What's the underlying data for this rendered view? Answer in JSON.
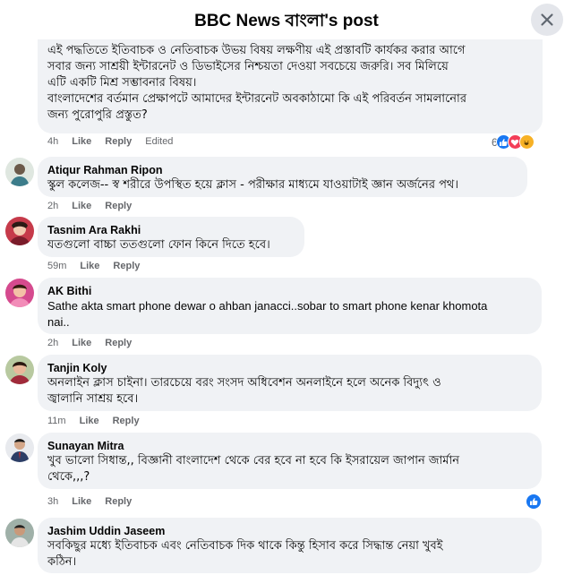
{
  "header": {
    "title": "BBC News বাংলা's post",
    "close_label": "close"
  },
  "comments": [
    {
      "name": "",
      "text": "এই পদ্ধতিতে ইতিবাচক ও নেতিবাচক উভয় বিষয় লক্ষণীয় এই প্রস্তাবটি কার্যকর করার আগে সবার জন্য সাশ্রয়ী ইন্টারনেট ও ডিভাইসের নিশ্চয়তা দেওয়া সবচেয়ে জরুরি। সব মিলিয়ে এটি একটি মিশ্র সম্ভাবনার বিষয়। বাংলাদেশের বর্তমান প্রেক্ষাপটে আমাদের ইন্টারনেট অবকাঠামো কি এই পরিবর্তন সামলানোর জন্য পুরোপুরি প্রস্তুত?",
      "lines": [
        "এই পদ্ধতিতে ইতিবাচক ও নেতিবাচক উভয় বিষয় লক্ষণীয় এই প্রস্তাবটি কার্যকর করার আগে",
        "সবার জন্য সাশ্রয়ী ইন্টারনেট ও ডিভাইসের নিশ্চয়তা দেওয়া সবচেয়ে জরুরি। সব মিলিয়ে",
        "এটি একটি মিশ্র সম্ভাবনার বিষয়।",
        "বাংলাদেশের বর্তমান প্রেক্ষাপটে আমাদের ইন্টারনেট অবকাঠামো কি এই পরিবর্তন সামলানোর",
        "জন্য পুরোপুরি প্রস্তুত?"
      ],
      "time": "4h",
      "like": "Like",
      "reply": "Reply",
      "edited": "Edited",
      "reaction_count": "6"
    },
    {
      "name": "Atiqur Rahman Ripon",
      "lines": [
        "স্কুল কলেজ-- স্ব শরীরে উপস্থিত হয়ে ক্লাস - পরীক্ষার মাধ্যমে যাওয়াটাই জ্ঞান অর্জনের পথ।"
      ],
      "time": "2h",
      "like": "Like",
      "reply": "Reply"
    },
    {
      "name": "Tasnim Ara Rakhi",
      "lines": [
        "যতগুলো বাচ্চা ততগুলো ফোন কিনে দিতে হবে।"
      ],
      "time": "59m",
      "like": "Like",
      "reply": "Reply"
    },
    {
      "name": "AK Bithi",
      "lines": [
        "Sathe akta smart phone dewar o ahban janacci..sobar to smart phone kenar khomota",
        "nai.."
      ],
      "time": "2h",
      "like": "Like",
      "reply": "Reply"
    },
    {
      "name": "Tanjin Koly",
      "lines": [
        "অনলাইন ক্লাস চাইনা। তারচেয়ে বরং সংসদ অধিবেশন অনলাইনে হলে অনেক বিদ্যুৎ ও",
        "জ্বালানি সাশ্রয় হবে।"
      ],
      "time": "11m",
      "like": "Like",
      "reply": "Reply"
    },
    {
      "name": "Sunayan Mitra",
      "lines": [
        "খুব ভালো সিধান্ত,, বিজ্ঞানী বাংলাদেশ থেকে বের হবে না হবে কি ইসরায়েল জাপান জার্মান",
        "থেকে,,,?"
      ],
      "time": "3h",
      "like": "Like",
      "reply": "Reply"
    },
    {
      "name": "Jashim Uddin Jaseem",
      "lines": [
        "সবকিছুর মধ্যে ইতিবাচক এবং নেতিবাচক দিক থাকে কিন্তু হিসাব করে সিদ্ধান্ত নেয়া খুবই",
        "কঠিন।"
      ]
    }
  ],
  "colors": {
    "bubble": "#f0f2f5",
    "meta": "#65676b",
    "like_blue": "#1877f2",
    "love_red": "#f33e58",
    "haha_yellow": "#f7b125"
  },
  "icons": [
    "close-icon",
    "like-reaction-icon",
    "love-reaction-icon",
    "haha-reaction-icon"
  ]
}
